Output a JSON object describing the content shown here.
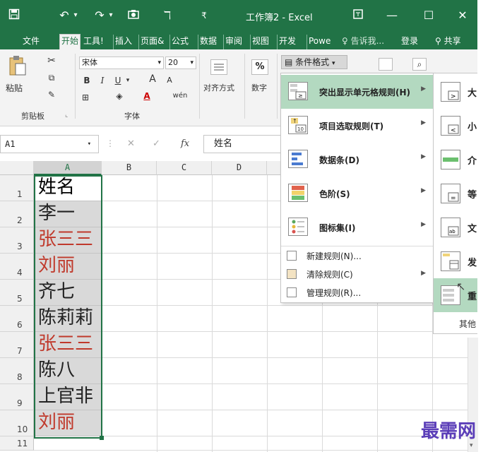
{
  "titlebar": {
    "title": "工作簿2 - Excel",
    "icons": [
      "save-icon",
      "undo-icon",
      "redo-icon",
      "camera-icon",
      "touch-mode-icon",
      "customize-icon",
      "ribbon-display-icon",
      "minimize-icon",
      "maximize-icon",
      "close-icon"
    ]
  },
  "tabs": {
    "file": "文件",
    "home": "开始",
    "tools": "工具!",
    "insert": "插入",
    "layout": "页面&",
    "formulas": "公式",
    "data": "数据",
    "review": "审阅",
    "view": "视图",
    "developer": "开发",
    "power": "Powe",
    "tellme": "告诉我...",
    "login": "登录",
    "share": "共享"
  },
  "ribbon": {
    "paste": "粘贴",
    "clipboard": "剪贴板",
    "font_name": "宋体",
    "font_size": "20",
    "bold": "B",
    "italic": "I",
    "underline": "U",
    "grow": "A",
    "shrink": "A",
    "fontcolor": "A",
    "phonetic": "wén",
    "font_group": "字体",
    "alignment": "对齐方式",
    "number": "数字",
    "number_sign": "%",
    "cond_format": "条件格式"
  },
  "formula_bar": {
    "name_box": "A1",
    "fx": "fx",
    "value": "姓名"
  },
  "sheet": {
    "columns": [
      "A",
      "B",
      "C",
      "D"
    ],
    "rows": [
      "1",
      "2",
      "3",
      "4",
      "5",
      "6",
      "7",
      "8",
      "9",
      "10",
      "11"
    ],
    "cells": [
      {
        "text": "姓名",
        "color": "#000000"
      },
      {
        "text": "李一",
        "color": "#222222"
      },
      {
        "text": "张三三",
        "color": "#c0392b"
      },
      {
        "text": "刘丽",
        "color": "#c0392b"
      },
      {
        "text": "齐七",
        "color": "#222222"
      },
      {
        "text": "陈莉莉",
        "color": "#222222"
      },
      {
        "text": "张三三",
        "color": "#c0392b"
      },
      {
        "text": "陈八",
        "color": "#222222"
      },
      {
        "text": "上官非",
        "color": "#222222"
      },
      {
        "text": "刘丽",
        "color": "#c0392b"
      }
    ]
  },
  "cf_menu": {
    "items": [
      {
        "label": "突出显示单元格规则(H)",
        "highlight": true
      },
      {
        "label": "项目选取规则(T)",
        "highlight": false
      },
      {
        "label": "数据条(D)",
        "highlight": false
      },
      {
        "label": "色阶(S)",
        "highlight": false
      },
      {
        "label": "图标集(I)",
        "highlight": false
      }
    ],
    "simple": [
      {
        "label": "新建规则(N)..."
      },
      {
        "label": "清除规则(C)"
      },
      {
        "label": "管理规则(R)..."
      }
    ]
  },
  "submenu": {
    "items": [
      {
        "label": "大"
      },
      {
        "label": "小"
      },
      {
        "label": "介"
      },
      {
        "label": "等"
      },
      {
        "label": "文"
      },
      {
        "label": "发"
      },
      {
        "label": "重"
      }
    ],
    "more": "其他"
  },
  "watermark": "最需网",
  "colors": {
    "accent": "#217346",
    "highlight": "#b3d9c0",
    "red_text": "#c0392b"
  }
}
